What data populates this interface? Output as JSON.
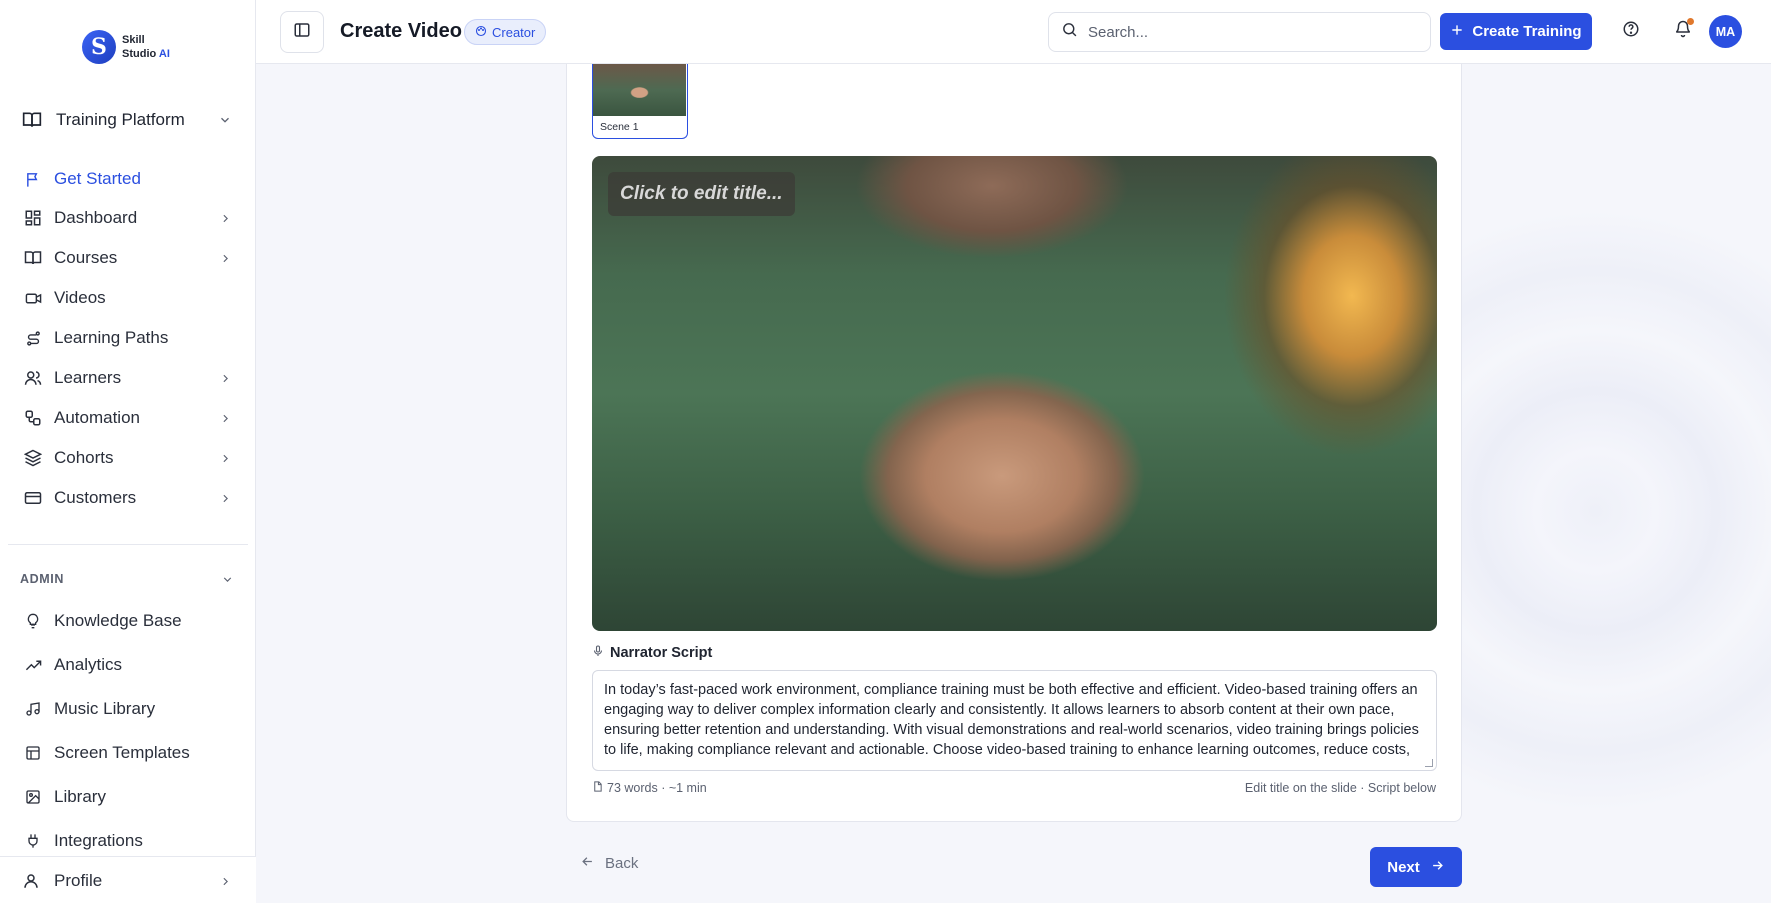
{
  "brand": {
    "line1": "Skill",
    "line2": "Studio",
    "line2_accent": "AI",
    "logo_letter": "S"
  },
  "sidebar": {
    "platform_label": "Training Platform",
    "items": [
      {
        "label": "Get Started",
        "icon": "flag-icon",
        "active": true,
        "expandable": false
      },
      {
        "label": "Dashboard",
        "icon": "grid-icon",
        "expandable": true
      },
      {
        "label": "Courses",
        "icon": "book-icon",
        "expandable": true
      },
      {
        "label": "Videos",
        "icon": "video-icon",
        "expandable": false
      },
      {
        "label": "Learning Paths",
        "icon": "route-icon",
        "expandable": false
      },
      {
        "label": "Learners",
        "icon": "users-icon",
        "expandable": true
      },
      {
        "label": "Automation",
        "icon": "workflow-icon",
        "expandable": true
      },
      {
        "label": "Cohorts",
        "icon": "layers-icon",
        "expandable": true
      },
      {
        "label": "Customers",
        "icon": "card-icon",
        "expandable": true
      }
    ],
    "admin_label": "ADMIN",
    "admin_items": [
      {
        "label": "Knowledge Base",
        "icon": "lightbulb-icon"
      },
      {
        "label": "Analytics",
        "icon": "trend-icon"
      },
      {
        "label": "Music Library",
        "icon": "music-icon"
      },
      {
        "label": "Screen Templates",
        "icon": "template-icon"
      },
      {
        "label": "Library",
        "icon": "image-icon"
      },
      {
        "label": "Integrations",
        "icon": "plug-icon"
      }
    ],
    "profile_label": "Profile"
  },
  "header": {
    "title": "Create Video",
    "badge": "Creator",
    "search_placeholder": "Search...",
    "create_button": "Create Training",
    "avatar_initials": "MA"
  },
  "editor": {
    "scene_label": "Scene 1",
    "title_placeholder": "Click to edit title...",
    "script_label": "Narrator Script",
    "script_text": "In today’s fast-paced work environment, compliance training must be both effective and efficient. Video-based training offers an engaging way to deliver complex information clearly and consistently. It allows learners to absorb content at their own pace, ensuring better retention and understanding. With visual demonstrations and real-world scenarios, video training brings policies to life, making compliance relevant and actionable. Choose video-based training to enhance learning outcomes, reduce costs, and meet regulatory requirements with confidence.",
    "word_count": "73 words · ~1 min",
    "hint": "Edit title on the slide · Script below"
  },
  "footer": {
    "back_label": "Back",
    "next_label": "Next"
  },
  "colors": {
    "accent": "#2b4fe0",
    "notification_dot": "#e0782c"
  }
}
